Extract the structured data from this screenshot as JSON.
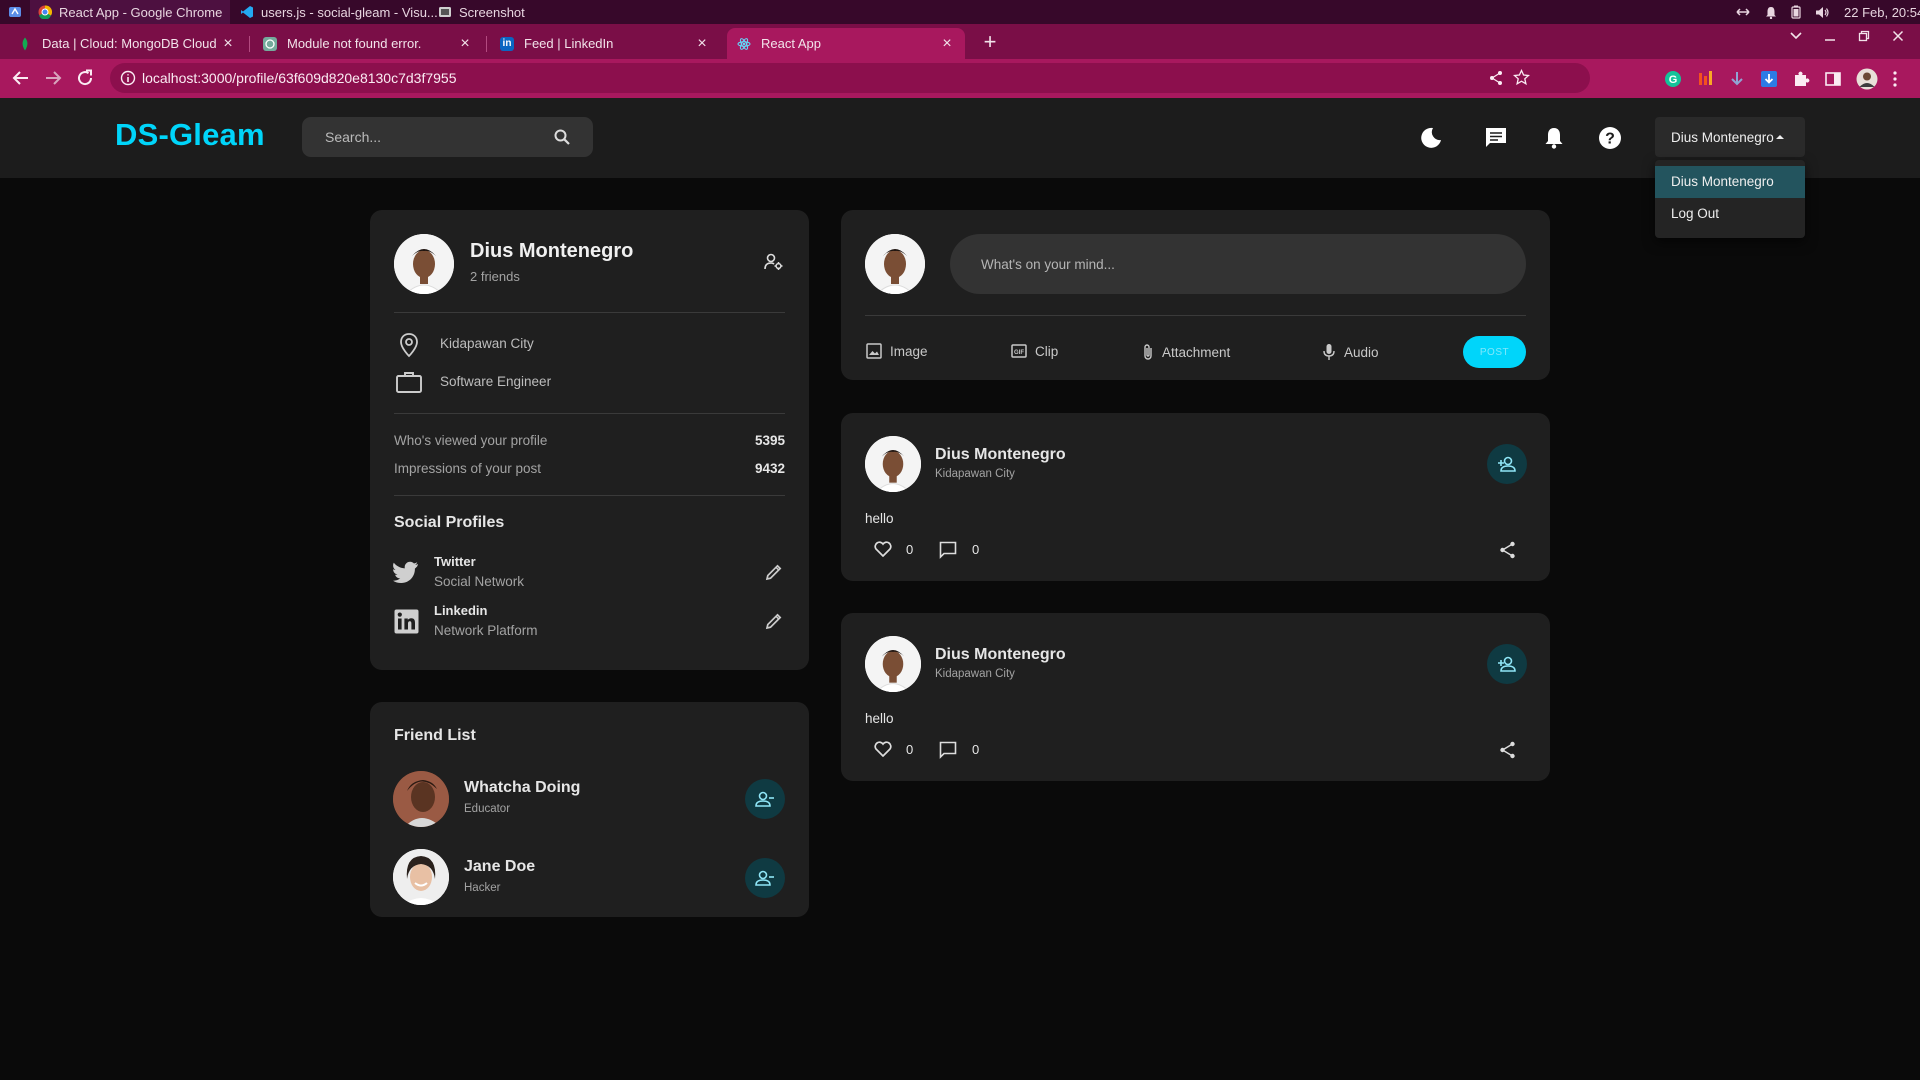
{
  "os": {
    "taskbar_items": [
      {
        "label": "React App - Google Chrome",
        "icon": "chrome-icon"
      },
      {
        "label": "users.js - social-gleam - Visu...",
        "icon": "vscode-icon"
      },
      {
        "label": "Screenshot",
        "icon": "screenshot-icon"
      }
    ],
    "clock": "22 Feb, 20:54"
  },
  "browser": {
    "tabs": [
      {
        "title": "Data | Cloud: MongoDB Cloud",
        "icon": "mongodb-icon"
      },
      {
        "title": "Module not found error.",
        "icon": "chatgpt-icon"
      },
      {
        "title": "Feed | LinkedIn",
        "icon": "linkedin-icon"
      },
      {
        "title": "React App",
        "icon": "react-icon"
      }
    ],
    "url": "localhost:3000/profile/63f609d820e8130c7d3f7955"
  },
  "app": {
    "logo": "DS-Gleam",
    "search_placeholder": "Search...",
    "user_select": "Dius Montenegro",
    "dropdown": [
      "Dius Montenegro",
      "Log Out"
    ]
  },
  "profile": {
    "name": "Dius Montenegro",
    "friends": "2 friends",
    "location": "Kidapawan City",
    "occupation": "Software Engineer",
    "stats": [
      {
        "label": "Who's viewed your profile",
        "value": "5395"
      },
      {
        "label": "Impressions of your post",
        "value": "9432"
      }
    ],
    "social_title": "Social Profiles",
    "socials": [
      {
        "name": "Twitter",
        "type": "Social Network"
      },
      {
        "name": "Linkedin",
        "type": "Network Platform"
      }
    ]
  },
  "friend_list": {
    "title": "Friend List",
    "friends": [
      {
        "name": "Whatcha Doing",
        "role": "Educator"
      },
      {
        "name": "Jane Doe",
        "role": "Hacker"
      }
    ]
  },
  "composer": {
    "placeholder": "What's on your mind...",
    "actions": [
      "Image",
      "Clip",
      "Attachment",
      "Audio"
    ],
    "post_label": "POST"
  },
  "posts": [
    {
      "name": "Dius Montenegro",
      "location": "Kidapawan City",
      "text": "hello",
      "likes": "0",
      "comments": "0"
    },
    {
      "name": "Dius Montenegro",
      "location": "Kidapawan City",
      "text": "hello",
      "likes": "0",
      "comments": "0"
    }
  ],
  "colors": {
    "accent": "#00d5fa",
    "chrome_tab": "#a8185e",
    "card": "#1f1f1f",
    "background": "#0a0a0a"
  }
}
